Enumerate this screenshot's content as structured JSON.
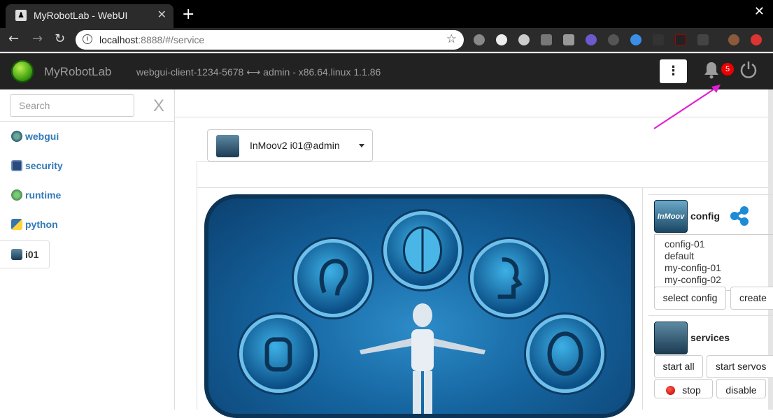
{
  "browser": {
    "tab_title": "MyRobotLab - WebUI",
    "tab_close": "✕",
    "new_tab": "+",
    "window_close": "✕",
    "url_host": "localhost",
    "url_rest": ":8888/#/service"
  },
  "header": {
    "brand": "MyRobotLab",
    "client_info": "webgui-client-1234-5678 ⟷ admin - x86.64.linux 1.1.86",
    "menu_glyph": "⋮",
    "notification_count": "5"
  },
  "sidebar": {
    "search_placeholder": "Search",
    "clear_label": "X",
    "items": [
      {
        "label": "webgui",
        "icon": "globe-icon"
      },
      {
        "label": "security",
        "icon": "lock-icon"
      },
      {
        "label": "runtime",
        "icon": "runtime-icon"
      },
      {
        "label": "python",
        "icon": "python-icon"
      },
      {
        "label": "i01",
        "icon": "inmoov-icon"
      }
    ]
  },
  "main": {
    "service_selector": "InMoov2  i01@admin",
    "config": {
      "title": "config",
      "options": [
        "config-01",
        "default",
        "my-config-01",
        "my-config-02"
      ],
      "select_button": "select config",
      "create_button": "create"
    },
    "services": {
      "title": "services",
      "start_all": "start all",
      "start_servos": "start servos",
      "stop": "stop",
      "disable": "disable"
    },
    "inmoov_icon_text": "InMoov"
  },
  "colors": {
    "link": "#337ab7",
    "appbar": "#222222",
    "badge": "#ee0000",
    "annotation_arrow": "#e020d0"
  }
}
